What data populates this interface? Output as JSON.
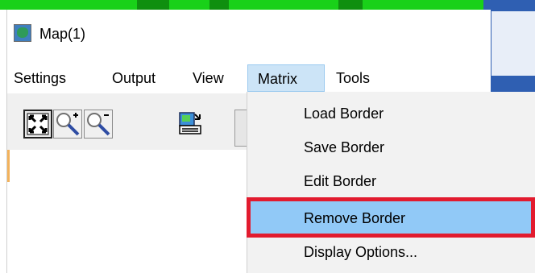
{
  "window": {
    "title": "Map(1)",
    "icon": "map-icon"
  },
  "menubar": {
    "items": [
      {
        "label": "Settings"
      },
      {
        "label": "Output"
      },
      {
        "label": "View"
      },
      {
        "label": "Matrix",
        "active": true
      },
      {
        "label": "Tools"
      }
    ]
  },
  "toolbar": {
    "buttons": [
      {
        "icon": "zoom-fit-icon"
      },
      {
        "icon": "zoom-in-icon"
      },
      {
        "icon": "zoom-out-icon"
      },
      {
        "icon": "export-icon"
      }
    ]
  },
  "dropdown": {
    "items": [
      {
        "label": "Load Border"
      },
      {
        "label": "Save Border"
      },
      {
        "label": "Edit Border"
      },
      {
        "label": "Remove Border",
        "highlighted": true
      },
      {
        "label": "Display Options..."
      }
    ]
  },
  "colors": {
    "highlight": "#91c9f7",
    "annotation_red": "#e21b2e",
    "menu_active_bg": "#cce4f7"
  }
}
